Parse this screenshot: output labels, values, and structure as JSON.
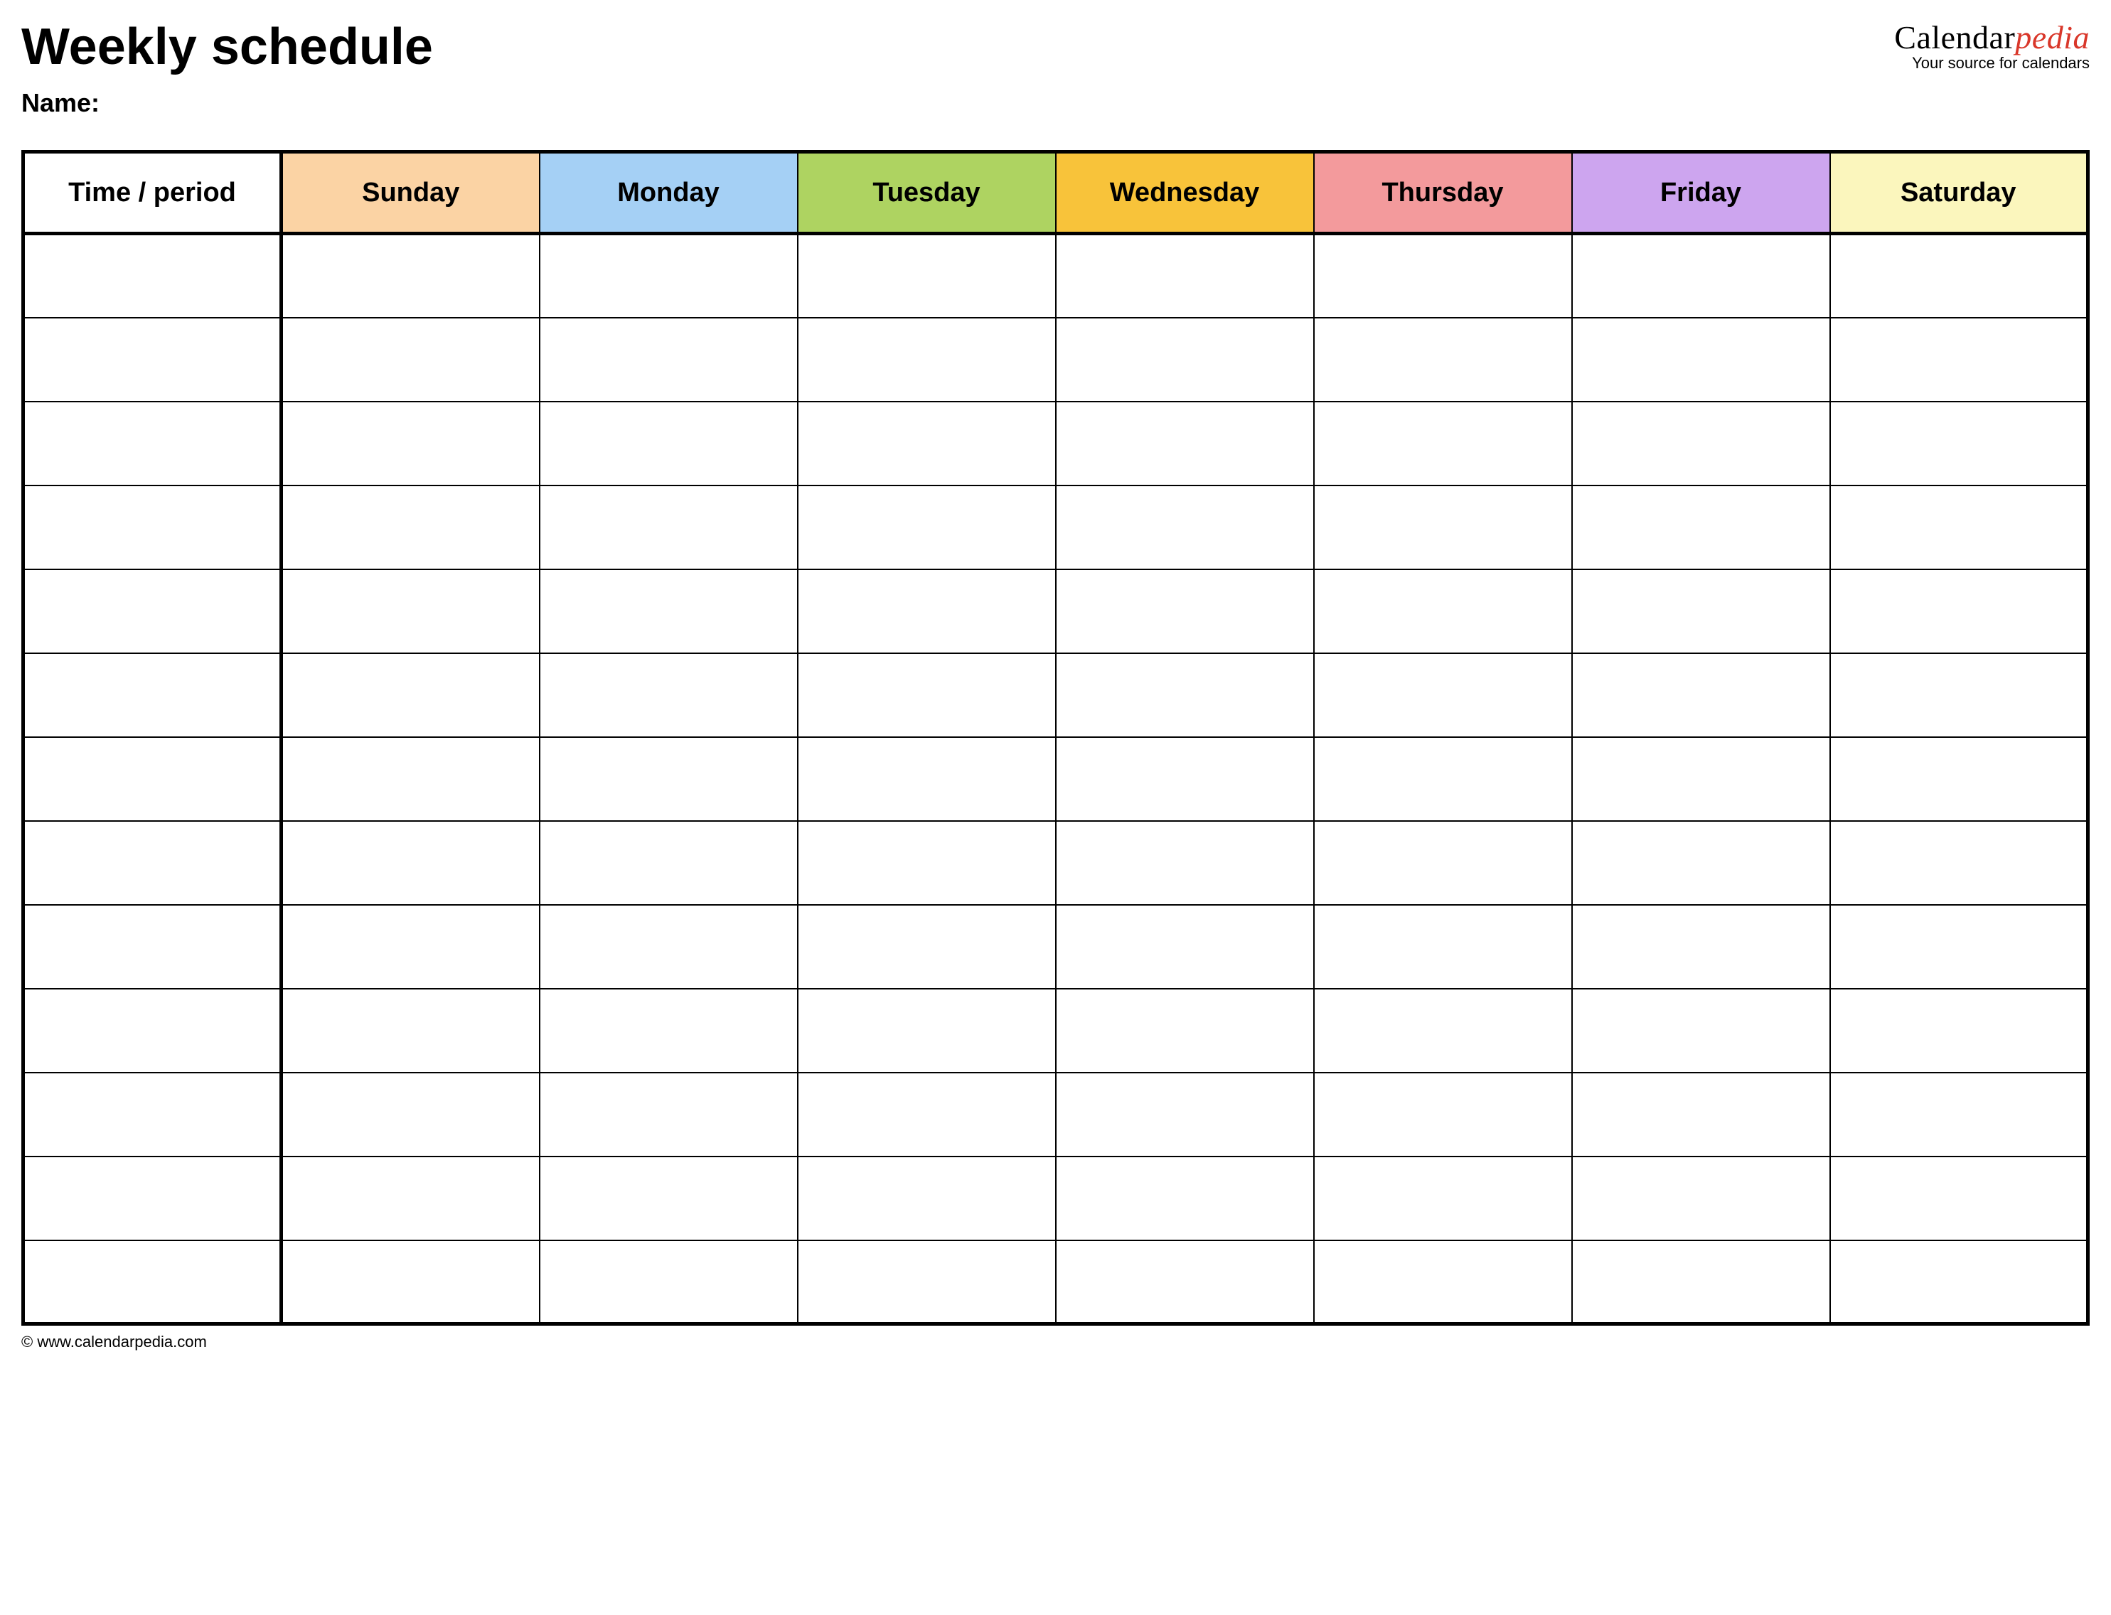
{
  "header": {
    "title": "Weekly schedule",
    "name_label": "Name:"
  },
  "brand": {
    "part1": "Calendar",
    "part2": "pedia",
    "tagline": "Your source for calendars"
  },
  "table": {
    "headers": [
      {
        "label": "Time / period",
        "bg": "#ffffff"
      },
      {
        "label": "Sunday",
        "bg": "#fbd3a4"
      },
      {
        "label": "Monday",
        "bg": "#a5d0f5"
      },
      {
        "label": "Tuesday",
        "bg": "#aed361"
      },
      {
        "label": "Wednesday",
        "bg": "#f8c33a"
      },
      {
        "label": "Thursday",
        "bg": "#f39a9c"
      },
      {
        "label": "Friday",
        "bg": "#cda5ef"
      },
      {
        "label": "Saturday",
        "bg": "#fbf6bd"
      }
    ],
    "row_count": 13
  },
  "footer": {
    "text": "© www.calendarpedia.com"
  }
}
